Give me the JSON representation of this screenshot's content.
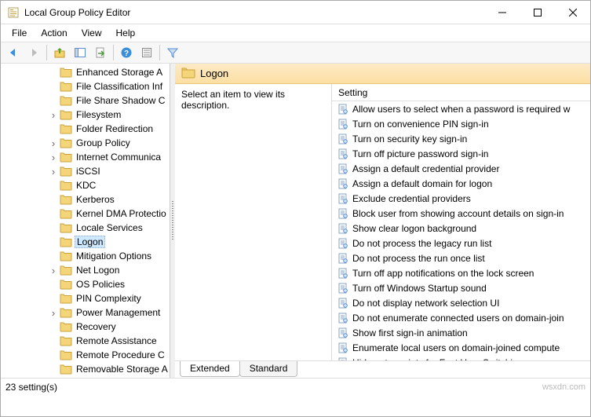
{
  "window": {
    "title": "Local Group Policy Editor"
  },
  "menu": {
    "file": "File",
    "action": "Action",
    "view": "View",
    "help": "Help"
  },
  "tree": {
    "items": [
      {
        "label": "Enhanced Storage A",
        "expandable": false
      },
      {
        "label": "File Classification Inf",
        "expandable": false
      },
      {
        "label": "File Share Shadow C",
        "expandable": false
      },
      {
        "label": "Filesystem",
        "expandable": true
      },
      {
        "label": "Folder Redirection",
        "expandable": false
      },
      {
        "label": "Group Policy",
        "expandable": true
      },
      {
        "label": "Internet Communica",
        "expandable": true
      },
      {
        "label": "iSCSI",
        "expandable": true
      },
      {
        "label": "KDC",
        "expandable": false
      },
      {
        "label": "Kerberos",
        "expandable": false
      },
      {
        "label": "Kernel DMA Protectio",
        "expandable": false
      },
      {
        "label": "Locale Services",
        "expandable": false
      },
      {
        "label": "Logon",
        "expandable": false,
        "selected": true
      },
      {
        "label": "Mitigation Options",
        "expandable": false
      },
      {
        "label": "Net Logon",
        "expandable": true
      },
      {
        "label": "OS Policies",
        "expandable": false
      },
      {
        "label": "PIN Complexity",
        "expandable": false
      },
      {
        "label": "Power Management",
        "expandable": true
      },
      {
        "label": "Recovery",
        "expandable": false
      },
      {
        "label": "Remote Assistance",
        "expandable": false
      },
      {
        "label": "Remote Procedure C",
        "expandable": false
      },
      {
        "label": "Removable Storage A",
        "expandable": false
      }
    ]
  },
  "detail": {
    "header": "Logon",
    "description": "Select an item to view its description.",
    "column": "Setting",
    "settings": [
      "Allow users to select when a password is required w",
      "Turn on convenience PIN sign-in",
      "Turn on security key sign-in",
      "Turn off picture password sign-in",
      "Assign a default credential provider",
      "Assign a default domain for logon",
      "Exclude credential providers",
      "Block user from showing account details on sign-in",
      "Show clear logon background",
      "Do not process the legacy run list",
      "Do not process the run once list",
      "Turn off app notifications on the lock screen",
      "Turn off Windows Startup sound",
      "Do not display network selection UI",
      "Do not enumerate connected users on domain-join",
      "Show first sign-in animation",
      "Enumerate local users on domain-joined compute",
      "Hide entry points for Fast User Switching"
    ]
  },
  "tabs": {
    "extended": "Extended",
    "standard": "Standard"
  },
  "status": {
    "count": "23 setting(s)"
  },
  "watermark": "wsxdn.com"
}
